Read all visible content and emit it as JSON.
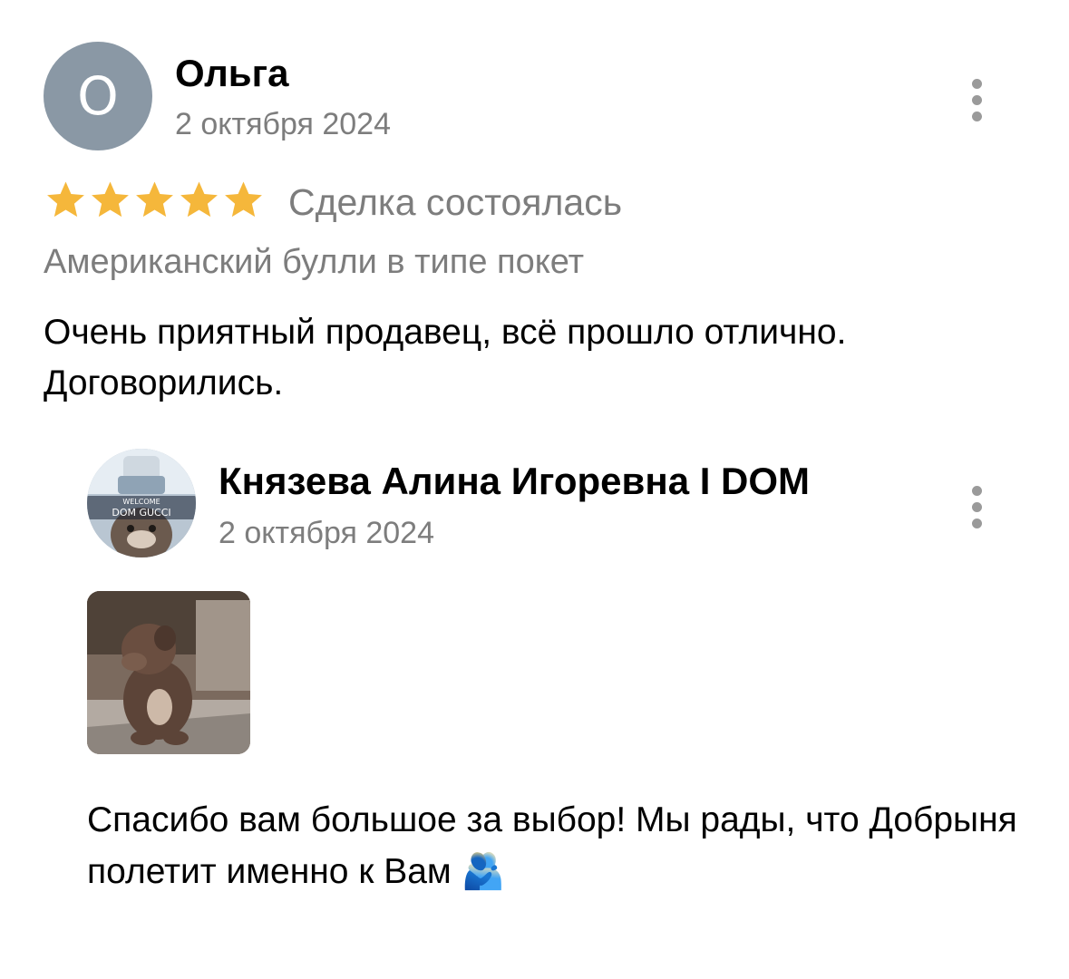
{
  "review": {
    "author": {
      "name": "Ольга",
      "initial": "О",
      "avatar_color": "#8a98a5"
    },
    "date": "2 октября 2024",
    "rating": 5,
    "star_color": "#f5b73b",
    "deal_status": "Сделка состоялась",
    "subject": "Американский булли в типе покет",
    "text": "Очень приятный продавец, всё прошло отлично. Договорились."
  },
  "reply": {
    "author": {
      "name": "Князева Алина Игоревна I DOM"
    },
    "avatar_image_text": [
      "WELCOME",
      "DOM GUCCI"
    ],
    "date": "2 октября 2024",
    "text": "Спасибо вам большое за выбор! Мы рады, что Добрыня полетит именно к Вам 🫂"
  },
  "icons": {
    "more": "kebab-menu-icon",
    "star": "star-icon"
  }
}
